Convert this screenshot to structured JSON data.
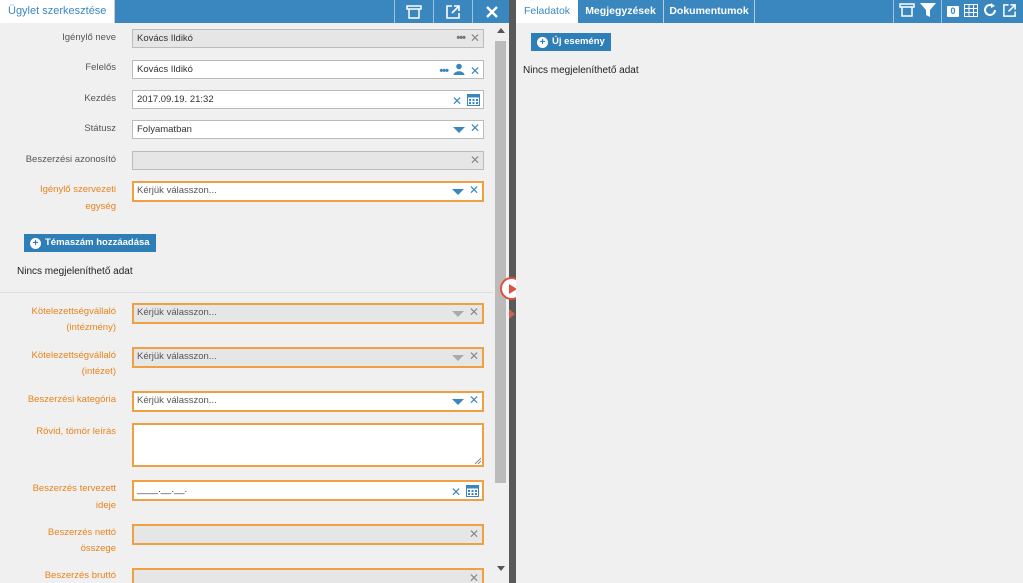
{
  "left": {
    "tab_title": "Ügylet szerkesztése",
    "fields": {
      "requester_label": "Igénylő neve",
      "requester_value": "Kovács Ildikó",
      "owner_label": "Felelős",
      "owner_value": "Kovács Ildikó",
      "start_label": "Kezdés",
      "start_value": "2017.09.19. 21:32",
      "status_label": "Státusz",
      "status_value": "Folyamatban",
      "procurement_id_label": "Beszerzési azonosító",
      "procurement_id_value": "",
      "org_unit_label_1": "Igénylő szervezeti",
      "org_unit_label_2": "egység",
      "org_unit_placeholder": "Kérjük válasszon...",
      "add_topic_button": "Témaszám hozzáadása",
      "no_data": "Nincs megjeleníthető adat",
      "obligor_inst_label_1": "Kötelezettségvállaló",
      "obligor_inst_label_2": "(intézmény)",
      "obligor_inst_placeholder": "Kérjük válasszon...",
      "obligor_institute_label_1": "Kötelezettségvállaló",
      "obligor_institute_label_2": "(intézet)",
      "obligor_institute_placeholder": "Kérjük válasszon...",
      "category_label": "Beszerzési kategória",
      "category_placeholder": "Kérjük válasszon...",
      "short_desc_label": "Rövid, tömör leírás",
      "planned_time_label_1": "Beszerzés tervezett",
      "planned_time_label_2": "ideje",
      "planned_time_value": "____.__.__.",
      "net_amount_label_1": "Beszerzés nettó",
      "net_amount_label_2": "összege",
      "gross_amount_label": "Beszerzés bruttó"
    }
  },
  "right": {
    "tabs": [
      "Feladatok",
      "Megjegyzések",
      "Dokumentumok"
    ],
    "new_event_button": "Új esemény",
    "no_data": "Nincs megjeleníthető adat",
    "badge_count": "0"
  },
  "colors": {
    "accent": "#3a87c0",
    "required_border": "#f0a040",
    "required_label": "#e8831a",
    "splitter_button": "#e05040"
  }
}
